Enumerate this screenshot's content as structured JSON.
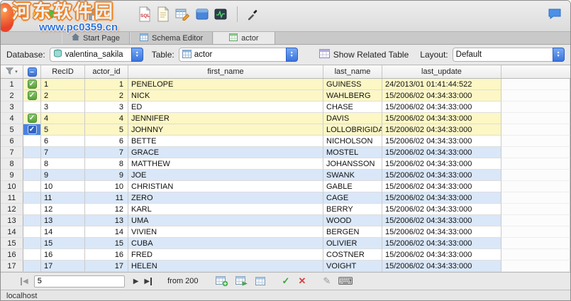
{
  "window": {
    "watermark_line1": "河东软件园",
    "watermark_line2": "www.pc0359.cn"
  },
  "tabs": [
    {
      "label": "Start Page"
    },
    {
      "label": "Schema Editor"
    },
    {
      "label": "actor",
      "active": true
    }
  ],
  "controls": {
    "database_label": "Database:",
    "database_value": "valentina_sakila",
    "table_label": "Table:",
    "table_value": "actor",
    "show_related_label": "Show Related Table",
    "layout_label": "Layout:",
    "layout_value": "Default"
  },
  "grid": {
    "columns": [
      "RecID",
      "actor_id",
      "first_name",
      "last_name",
      "last_update"
    ],
    "rows": [
      {
        "num": 1,
        "recid": 1,
        "actor_id": 1,
        "first_name": "PENELOPE",
        "last_name": "GUINESS",
        "last_update": "24/2013/01 01:41:44:522",
        "checked": true,
        "selected": false,
        "bg": "yellow"
      },
      {
        "num": 2,
        "recid": 2,
        "actor_id": 2,
        "first_name": "NICK",
        "last_name": "WAHLBERG",
        "last_update": "15/2006/02 04:34:33:000",
        "checked": true,
        "selected": false,
        "bg": "yellow"
      },
      {
        "num": 3,
        "recid": 3,
        "actor_id": 3,
        "first_name": "ED",
        "last_name": "CHASE",
        "last_update": "15/2006/02 04:34:33:000",
        "checked": false,
        "selected": false,
        "bg": "white"
      },
      {
        "num": 4,
        "recid": 4,
        "actor_id": 4,
        "first_name": "JENNIFER",
        "last_name": "DAVIS",
        "last_update": "15/2006/02 04:34:33:000",
        "checked": true,
        "selected": false,
        "bg": "yellow"
      },
      {
        "num": 5,
        "recid": 5,
        "actor_id": 5,
        "first_name": "JOHNNY",
        "last_name": "LOLLOBRIGIDA",
        "last_update": "15/2006/02 04:34:33:000",
        "checked": true,
        "selected": true,
        "bg": "yellow"
      },
      {
        "num": 6,
        "recid": 6,
        "actor_id": 6,
        "first_name": "BETTE",
        "last_name": "NICHOLSON",
        "last_update": "15/2006/02 04:34:33:000",
        "checked": false,
        "selected": false,
        "bg": "white"
      },
      {
        "num": 7,
        "recid": 7,
        "actor_id": 7,
        "first_name": "GRACE",
        "last_name": "MOSTEL",
        "last_update": "15/2006/02 04:34:33:000",
        "checked": false,
        "selected": false,
        "bg": "blue"
      },
      {
        "num": 8,
        "recid": 8,
        "actor_id": 8,
        "first_name": "MATTHEW",
        "last_name": "JOHANSSON",
        "last_update": "15/2006/02 04:34:33:000",
        "checked": false,
        "selected": false,
        "bg": "white"
      },
      {
        "num": 9,
        "recid": 9,
        "actor_id": 9,
        "first_name": "JOE",
        "last_name": "SWANK",
        "last_update": "15/2006/02 04:34:33:000",
        "checked": false,
        "selected": false,
        "bg": "blue"
      },
      {
        "num": 10,
        "recid": 10,
        "actor_id": 10,
        "first_name": "CHRISTIAN",
        "last_name": "GABLE",
        "last_update": "15/2006/02 04:34:33:000",
        "checked": false,
        "selected": false,
        "bg": "white"
      },
      {
        "num": 11,
        "recid": 11,
        "actor_id": 11,
        "first_name": "ZERO",
        "last_name": "CAGE",
        "last_update": "15/2006/02 04:34:33:000",
        "checked": false,
        "selected": false,
        "bg": "blue"
      },
      {
        "num": 12,
        "recid": 12,
        "actor_id": 12,
        "first_name": "KARL",
        "last_name": "BERRY",
        "last_update": "15/2006/02 04:34:33:000",
        "checked": false,
        "selected": false,
        "bg": "white"
      },
      {
        "num": 13,
        "recid": 13,
        "actor_id": 13,
        "first_name": "UMA",
        "last_name": "WOOD",
        "last_update": "15/2006/02 04:34:33:000",
        "checked": false,
        "selected": false,
        "bg": "blue"
      },
      {
        "num": 14,
        "recid": 14,
        "actor_id": 14,
        "first_name": "VIVIEN",
        "last_name": "BERGEN",
        "last_update": "15/2006/02 04:34:33:000",
        "checked": false,
        "selected": false,
        "bg": "white"
      },
      {
        "num": 15,
        "recid": 15,
        "actor_id": 15,
        "first_name": "CUBA",
        "last_name": "OLIVIER",
        "last_update": "15/2006/02 04:34:33:000",
        "checked": false,
        "selected": false,
        "bg": "blue"
      },
      {
        "num": 16,
        "recid": 16,
        "actor_id": 16,
        "first_name": "FRED",
        "last_name": "COSTNER",
        "last_update": "15/2006/02 04:34:33:000",
        "checked": false,
        "selected": false,
        "bg": "white"
      },
      {
        "num": 17,
        "recid": 17,
        "actor_id": 17,
        "first_name": "HELEN",
        "last_name": "VOIGHT",
        "last_update": "15/2006/02 04:34:33:000",
        "checked": false,
        "selected": false,
        "bg": "blue"
      }
    ]
  },
  "nav": {
    "position_value": "5",
    "from_label": "from 200"
  },
  "statusbar": {
    "text": "localhost"
  },
  "icons": {
    "select_all": "–",
    "checkbox_check": "✓",
    "first_record": "◀",
    "next_record": "▶",
    "last_record": "▶",
    "accept": "✓",
    "cancel": "✕",
    "edit_pencil": "✎",
    "keyboard": "⌨",
    "popup_up": "▲",
    "popup_down": "▼",
    "funnel_drop": "▾"
  },
  "colors": {
    "row_yellow": "#fcf7c5",
    "row_blue": "#d9e7f8",
    "row_white": "#ffffff",
    "selected_cell_blue": "#4a82e0",
    "checkbox_green": "#55a23a",
    "accent_blue": "#3a74dd"
  }
}
